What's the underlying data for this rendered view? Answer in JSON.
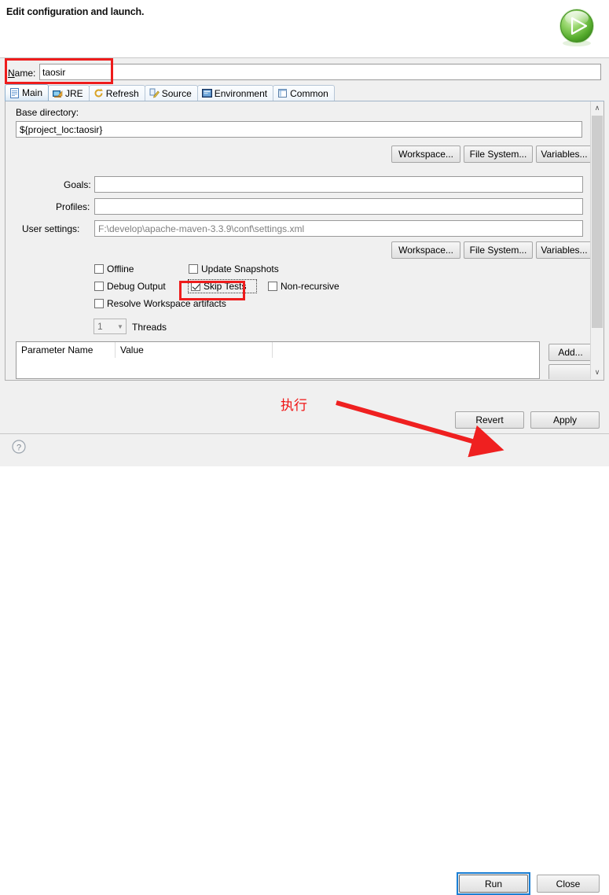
{
  "header": {
    "title": "Edit configuration and launch.",
    "run_icon": "run-play-icon"
  },
  "name_row": {
    "label": "Name:",
    "label_mnemonic": "N",
    "value": "taosir",
    "placeholder": ""
  },
  "tabs": [
    {
      "label": "Main",
      "icon": "document-icon",
      "selected": true
    },
    {
      "label": "JRE",
      "icon": "jre-icon",
      "selected": false
    },
    {
      "label": "Refresh",
      "icon": "refresh-icon",
      "selected": false
    },
    {
      "label": "Source",
      "icon": "source-icon",
      "selected": false
    },
    {
      "label": "Environment",
      "icon": "environment-icon",
      "selected": false
    },
    {
      "label": "Common",
      "icon": "common-icon",
      "selected": false
    }
  ],
  "main_tab": {
    "base_directory": {
      "label": "Base directory:",
      "value": "${project_loc:taosir}",
      "buttons": [
        "Workspace...",
        "File System...",
        "Variables..."
      ]
    },
    "fields": [
      {
        "label": "Goals:",
        "value": "",
        "muted": false
      },
      {
        "label": "Profiles:",
        "value": "",
        "muted": false
      },
      {
        "label": "User settings:",
        "value": "F:\\develop\\apache-maven-3.3.9\\conf\\settings.xml",
        "muted": true
      }
    ],
    "settings_buttons": [
      "Workspace...",
      "File System...",
      "Variables..."
    ],
    "checkboxes": [
      {
        "label": "Offline",
        "checked": false,
        "focused": false
      },
      {
        "label": "Update Snapshots",
        "checked": false,
        "focused": false
      },
      {
        "label": "Debug Output",
        "checked": false,
        "focused": false
      },
      {
        "label": "Skip Tests",
        "checked": true,
        "focused": true
      },
      {
        "label": "Non-recursive",
        "checked": false,
        "focused": false
      },
      {
        "label": "Resolve Workspace artifacts",
        "checked": false,
        "focused": false
      }
    ],
    "threads": {
      "value": "1",
      "label": "Threads",
      "enabled": false
    },
    "parameter_table": {
      "columns": [
        "Parameter Name",
        "Value"
      ],
      "rows": [],
      "buttons": [
        "Add..."
      ]
    }
  },
  "footer": {
    "revert_label": "Revert",
    "apply_label": "Apply",
    "run_label": "Run",
    "close_label": "Close",
    "help_icon": "help-question-icon"
  },
  "annotations": {
    "text": "执行",
    "arrow": "red-arrow-pointing-to-run",
    "rect_name": "red-highlight-name-field",
    "rect_skip_tests": "red-highlight-skip-tests"
  },
  "colors": {
    "annotation_red": "#ee1c1c",
    "focus_blue": "#1b7fd4",
    "panel_bg": "#f0f0f0",
    "run_green": "#59b030"
  },
  "scrollbar": {
    "up_glyph": "∧",
    "down_glyph": "∨"
  }
}
